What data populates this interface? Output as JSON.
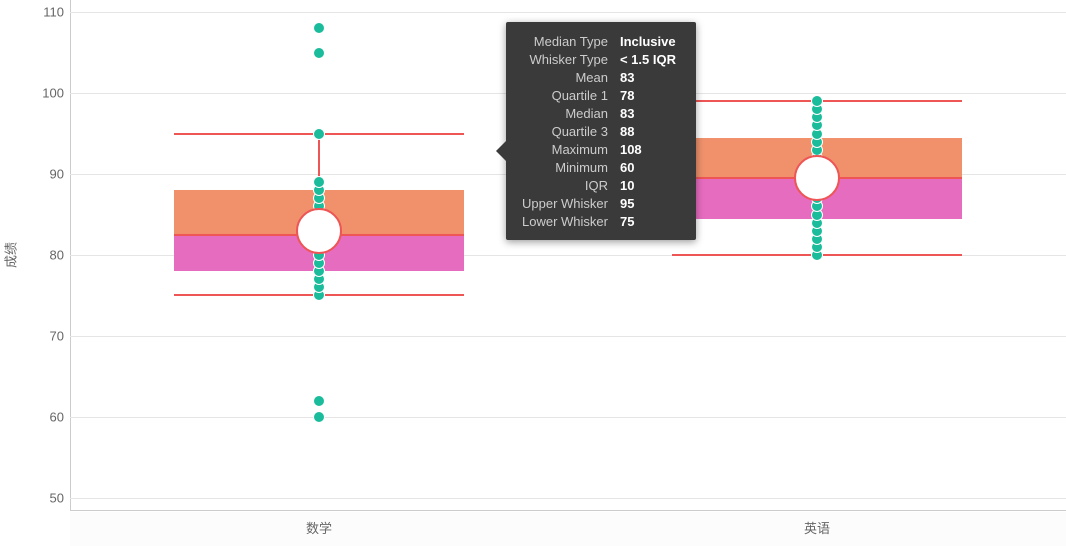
{
  "axis": {
    "yTitle": "成绩",
    "yTicks": [
      50,
      60,
      70,
      80,
      90,
      100,
      110
    ],
    "yMin": 48.5,
    "yMax": 111.5,
    "categories": [
      "数学",
      "英语"
    ]
  },
  "tooltip": {
    "rows": [
      {
        "k": "Median Type",
        "v": "Inclusive"
      },
      {
        "k": "Whisker Type",
        "v": "< 1.5 IQR"
      },
      {
        "k": "Mean",
        "v": "83"
      },
      {
        "k": "Quartile 1",
        "v": "78"
      },
      {
        "k": "Median",
        "v": "83"
      },
      {
        "k": "Quartile 3",
        "v": "88"
      },
      {
        "k": "Maximum",
        "v": "108"
      },
      {
        "k": "Minimum",
        "v": "60"
      },
      {
        "k": "IQR",
        "v": "10"
      },
      {
        "k": "Upper Whisker",
        "v": "95"
      },
      {
        "k": "Lower Whisker",
        "v": "75"
      }
    ]
  },
  "chart_data": {
    "type": "boxplot",
    "ylabel": "成绩",
    "ylim": [
      48.5,
      111.5
    ],
    "categories": [
      "数学",
      "英语"
    ],
    "series": [
      {
        "name": "数学",
        "q1": 78,
        "median": 82.5,
        "q3": 88,
        "mean": 83,
        "lowerWhisker": 75,
        "upperWhisker": 95,
        "min": 60,
        "max": 108,
        "iqr": 10,
        "points": [
          60,
          62,
          75,
          76,
          77,
          78,
          79,
          80,
          81,
          82,
          83,
          84,
          85,
          86,
          87,
          88,
          89,
          95,
          105,
          108
        ]
      },
      {
        "name": "英语",
        "q1": 84.5,
        "median": 89.5,
        "q3": 94.5,
        "mean": 89.5,
        "lowerWhisker": 80,
        "upperWhisker": 99,
        "min": 80,
        "max": 99,
        "iqr": 10,
        "points": [
          80,
          81,
          82,
          83,
          84,
          85,
          86,
          87,
          88,
          89,
          90,
          91,
          92,
          93,
          94,
          95,
          96,
          97,
          98,
          99
        ]
      }
    ],
    "colors": {
      "upperBox": "#f0916c",
      "lowerBox": "#e66cc0",
      "line": "#e55",
      "point": "#1abc9c"
    }
  }
}
